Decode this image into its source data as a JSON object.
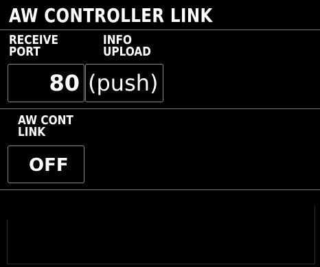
{
  "header": {
    "title": "AW CONTROLLER LINK"
  },
  "receive_port": {
    "label": "RECEIVE\nPORT",
    "value": "80"
  },
  "info_upload": {
    "label": "INFO\nUPLOAD",
    "value": "(push)"
  },
  "aw_cont_link": {
    "label": "AW CONT\nLINK",
    "value": "OFF"
  },
  "colors": {
    "background": "#000000",
    "text": "#ffffff",
    "border": "#8a8a8a"
  }
}
